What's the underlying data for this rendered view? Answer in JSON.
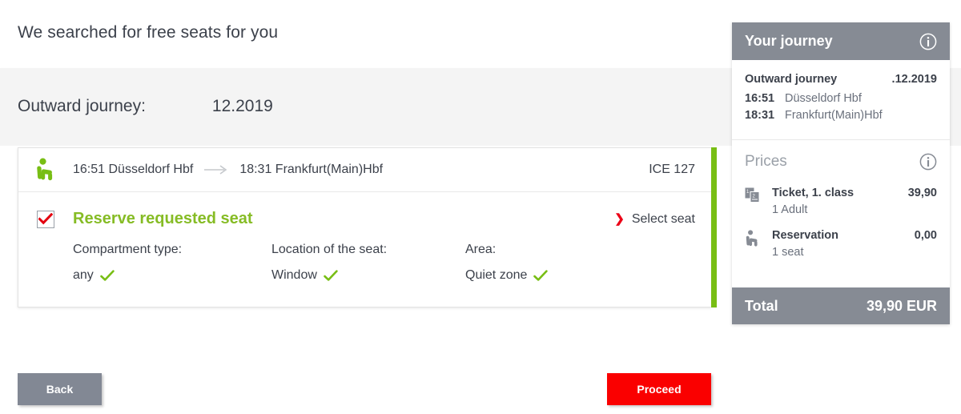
{
  "page": {
    "headline": "We searched for free seats for you"
  },
  "journey_header": {
    "label": "Outward journey:",
    "date": "12.2019"
  },
  "seat_card": {
    "seat_icon": "seat-icon",
    "departure": "16:51 Düsseldorf Hbf",
    "arrow_icon": "arrow-right-icon",
    "arrival": "18:31 Frankfurt(Main)Hbf",
    "train_number": "ICE 127",
    "checkbox_checked": true,
    "reserve_title": "Reserve requested seat",
    "select_seat_label": "Select seat",
    "select_seat_chevron": "chevron-right-icon",
    "options": [
      {
        "label": "Compartment type:",
        "value": "any",
        "check_icon": "check-icon"
      },
      {
        "label": "Location of the seat:",
        "value": "Window",
        "check_icon": "check-icon"
      },
      {
        "label": "Area:",
        "value": "Quiet zone",
        "check_icon": "check-icon"
      }
    ]
  },
  "footer": {
    "back_label": "Back",
    "proceed_label": "Proceed"
  },
  "sidebar": {
    "header": {
      "title": "Your journey",
      "info_icon": "info-icon"
    },
    "journey": {
      "title": "Outward journey",
      "date": ".12.2019",
      "stops": [
        {
          "time": "16:51",
          "station": "Düsseldorf Hbf"
        },
        {
          "time": "18:31",
          "station": "Frankfurt(Main)Hbf"
        }
      ]
    },
    "prices": {
      "title": "Prices",
      "info_icon": "info-icon",
      "items": [
        {
          "icon": "ticket-icon",
          "name": "Ticket, 1. class",
          "amount": "39,90",
          "sub": "1 Adult"
        },
        {
          "icon": "seat-icon",
          "name": "Reservation",
          "amount": "0,00",
          "sub": "1 seat"
        }
      ]
    },
    "total": {
      "label": "Total",
      "value": "39,90 EUR"
    }
  },
  "colors": {
    "brand_green": "#78be14",
    "accent_red": "#ec0016",
    "proceed_red": "#fa0000",
    "panel_gray": "#868b94",
    "text_dark": "#3c414b",
    "text_muted": "#6a707c"
  }
}
